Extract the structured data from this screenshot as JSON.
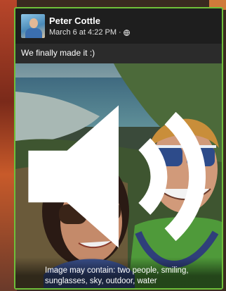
{
  "post": {
    "author": "Peter Cottle",
    "date": "March 6 at 4:22 PM",
    "separator": "·",
    "privacy_icon": "globe-icon",
    "text": "We finally made it :)",
    "image_alt": "Image may contain: two people, smiling, sunglasses, sky, outdoor, water",
    "speaker_icon": "speaker-icon"
  },
  "colors": {
    "card_border": "#6fbf3a",
    "text": "#ffffff"
  }
}
